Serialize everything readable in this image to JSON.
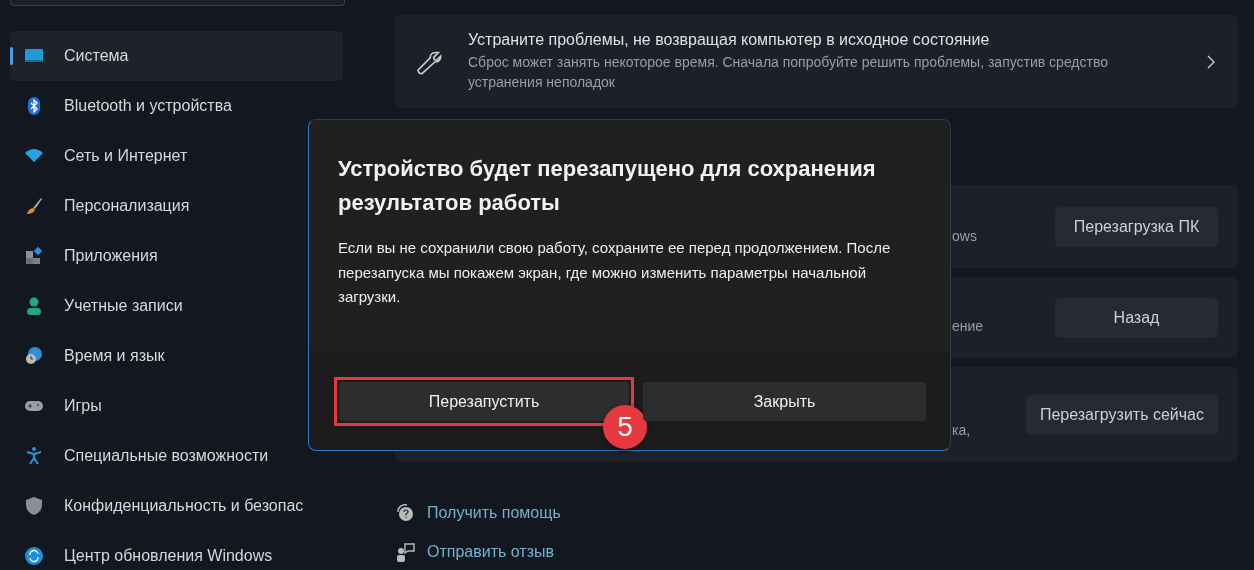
{
  "sidebar": {
    "items": [
      {
        "label": "Система",
        "selected": true
      },
      {
        "label": "Bluetooth и устройства",
        "selected": false
      },
      {
        "label": "Сеть и Интернет",
        "selected": false
      },
      {
        "label": "Персонализация",
        "selected": false
      },
      {
        "label": "Приложения",
        "selected": false
      },
      {
        "label": "Учетные записи",
        "selected": false
      },
      {
        "label": "Время и язык",
        "selected": false
      },
      {
        "label": "Игры",
        "selected": false
      },
      {
        "label": "Специальные возможности",
        "selected": false
      },
      {
        "label": "Конфиденциальность и безопас",
        "selected": false
      },
      {
        "label": "Центр обновления Windows",
        "selected": false
      }
    ]
  },
  "troubleshoot_card": {
    "title": "Устраните проблемы, не возвращая компьютер в исходное состояние",
    "description": "Сброс может занять некоторое время. Сначала попробуйте решить проблемы, запустив средство устранения неполадок"
  },
  "recovery_cards": [
    {
      "text_fragment": "ows",
      "button": "Перезагрузка ПК"
    },
    {
      "text_fragment": "ение",
      "button": "Назад"
    },
    {
      "text_fragment": "ка,",
      "button": "Перезагрузить сейчас"
    }
  ],
  "links": [
    {
      "label": "Получить помощь"
    },
    {
      "label": "Отправить отзыв"
    }
  ],
  "dialog": {
    "title": "Устройство будет перезапущено для сохранения результатов работы",
    "body": "Если вы не сохранили свою работу, сохраните ее перед продолжением. После перезапуска мы покажем экран, где можно изменить параметры начальной загрузки.",
    "buttons": [
      {
        "label": "Перезапустить",
        "highlighted": true
      },
      {
        "label": "Закрыть",
        "highlighted": false
      }
    ],
    "step_badge": "5"
  }
}
